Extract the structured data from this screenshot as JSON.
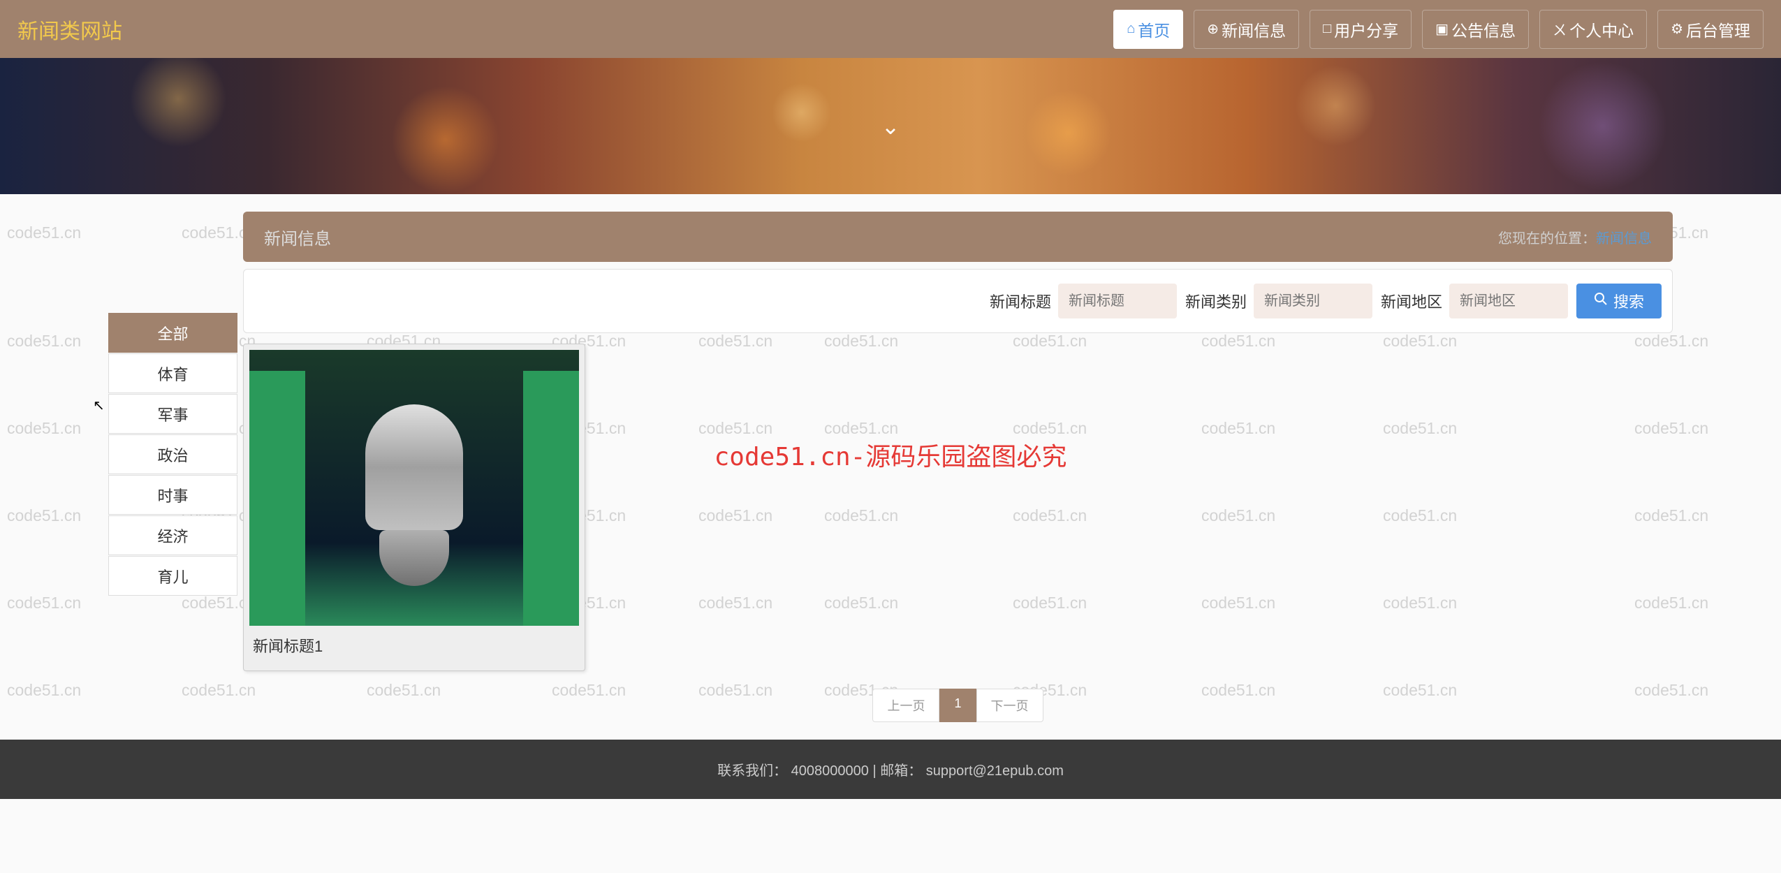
{
  "site_title": "新闻类网站",
  "nav": [
    {
      "icon": "⌂",
      "label": "首页",
      "active": true
    },
    {
      "icon": "⊕",
      "label": "新闻信息",
      "active": false
    },
    {
      "icon": "□",
      "label": "用户分享",
      "active": false
    },
    {
      "icon": "▣",
      "label": "公告信息",
      "active": false
    },
    {
      "icon": "ㄨ",
      "label": "个人中心",
      "active": false
    },
    {
      "icon": "⚙",
      "label": "后台管理",
      "active": false
    }
  ],
  "breadcrumb": {
    "title": "新闻信息",
    "location_label": "您现在的位置：",
    "current": "新闻信息"
  },
  "search": {
    "fields": [
      {
        "label": "新闻标题",
        "placeholder": "新闻标题"
      },
      {
        "label": "新闻类别",
        "placeholder": "新闻类别"
      },
      {
        "label": "新闻地区",
        "placeholder": "新闻地区"
      }
    ],
    "button": "搜索"
  },
  "sidebar": [
    {
      "label": "全部",
      "active": true
    },
    {
      "label": "体育",
      "active": false
    },
    {
      "label": "军事",
      "active": false
    },
    {
      "label": "政治",
      "active": false
    },
    {
      "label": "时事",
      "active": false
    },
    {
      "label": "经济",
      "active": false
    },
    {
      "label": "育儿",
      "active": false
    }
  ],
  "cards": [
    {
      "title": "新闻标题1"
    }
  ],
  "pagination": {
    "prev": "上一页",
    "pages": [
      "1"
    ],
    "next": "下一页"
  },
  "footer": {
    "contact_label": "联系我们：",
    "phone": "4008000000",
    "sep": " | ",
    "email_label": "邮箱：",
    "email": "support@21epub.com"
  },
  "watermark_text": "code51.cn",
  "watermark_center": "code51.cn-源码乐园盗图必究"
}
